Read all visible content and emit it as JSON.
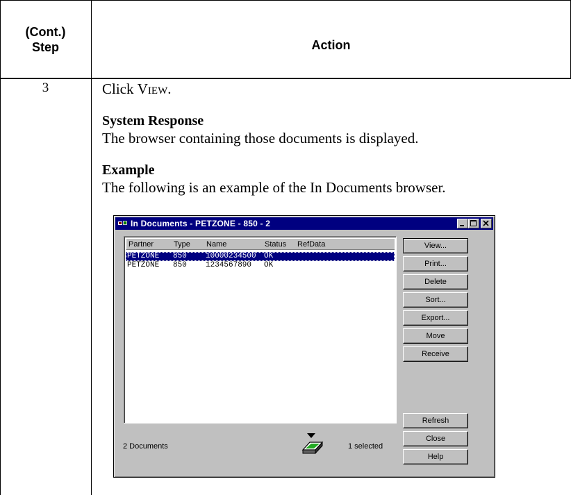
{
  "header": {
    "step_line1": "(Cont.)",
    "step_line2": "Step",
    "action": "Action"
  },
  "step": {
    "number": "3",
    "instruction_prefix": "Click ",
    "instruction_command": "View",
    "instruction_suffix": ".",
    "system_response_heading": "System Response",
    "system_response_text": "The browser containing those documents is displayed.",
    "example_heading": "Example",
    "example_text": "The following is an example of the In Documents browser."
  },
  "dialog": {
    "title": "In Documents - PETZONE - 850 - 2",
    "columns": [
      "Partner",
      "Type",
      "Name",
      "Status",
      "RefData"
    ],
    "rows": [
      {
        "partner": "PETZONE",
        "type": "850",
        "name": "10000234500",
        "status": "OK",
        "refdata": "",
        "selected": true
      },
      {
        "partner": "PETZONE",
        "type": "850",
        "name": "1234567890",
        "status": "OK",
        "refdata": "",
        "selected": false
      }
    ],
    "buttons": {
      "view": "View...",
      "print": "Print...",
      "delete": "Delete",
      "sort": "Sort...",
      "export": "Export...",
      "move": "Move",
      "receive": "Receive",
      "refresh": "Refresh",
      "close": "Close",
      "help": "Help"
    },
    "status_left": "2 Documents",
    "status_right": "1 selected",
    "icons": {
      "title": "app-icon",
      "tray": "in-tray-icon"
    },
    "colors": {
      "titlebar": "#000080",
      "selection": "#000080",
      "tray_green": "#22aa22"
    }
  }
}
